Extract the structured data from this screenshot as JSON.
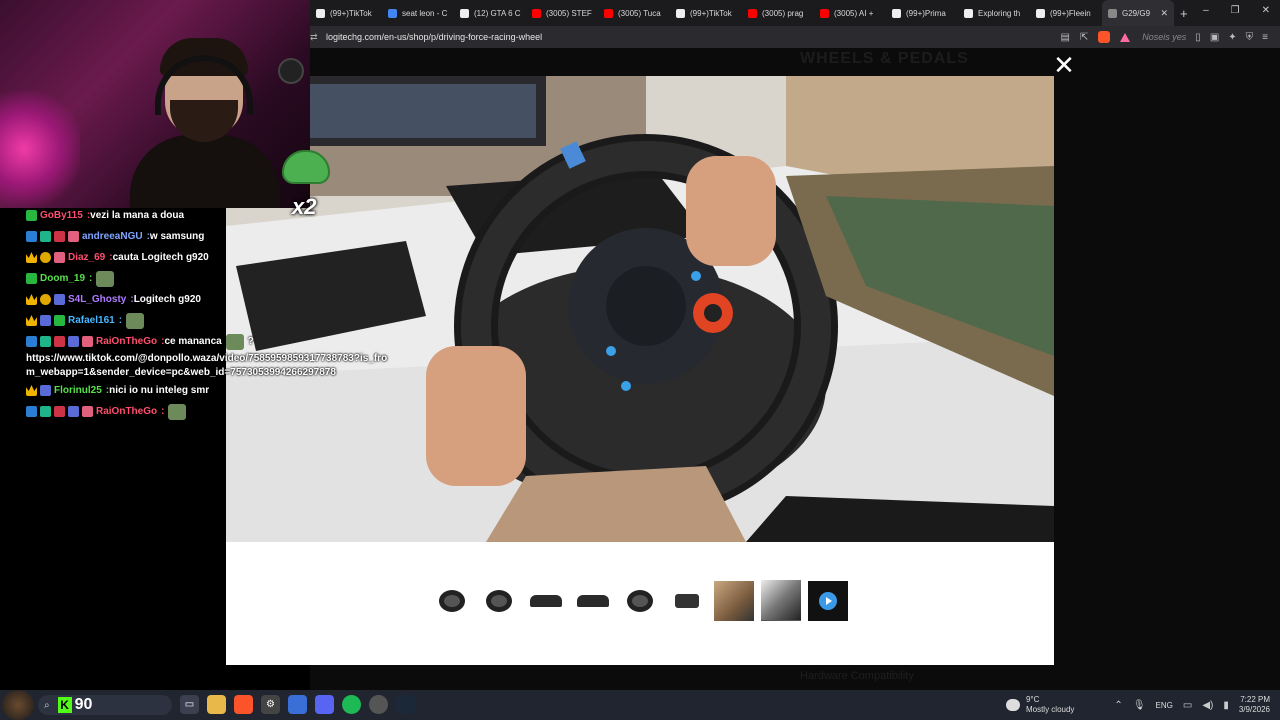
{
  "webcam": {
    "emote_multiplier": "x2"
  },
  "chat": {
    "messages": [
      {
        "user": "GoBy115",
        "user_color": "#ff4f6e",
        "text": "vezi la mana a doua",
        "badges": [
          "gem"
        ]
      },
      {
        "user": "andreeaNGU",
        "user_color": "#7ea6ff",
        "text": "w samsung",
        "badges": [
          "arrow",
          "grid",
          "heart",
          "gift"
        ]
      },
      {
        "user": "Diaz_69",
        "user_color": "#ff4f6e",
        "text": "cauta Logitech g920",
        "badges": [
          "crown",
          "dot",
          "gift"
        ]
      },
      {
        "user": "Doom_19",
        "user_color": "#56e04a",
        "text": "",
        "badges": [
          "gem"
        ],
        "emote": true
      },
      {
        "user": "S4L_Ghosty",
        "user_color": "#b07cff",
        "text": "Logitech g920",
        "badges": [
          "crown",
          "dot",
          "sub"
        ]
      },
      {
        "user": "Rafael161",
        "user_color": "#48b8ff",
        "text": "",
        "badges": [
          "crown",
          "sub",
          "gem"
        ],
        "emote": true
      },
      {
        "user": "RaiOnTheGo",
        "user_color": "#ff4f6e",
        "text": "ce mananca",
        "badges": [
          "arrow",
          "grid",
          "heart",
          "sub",
          "gift"
        ],
        "emote": true,
        "trail": "?"
      },
      {
        "user": "Florinul25",
        "user_color": "#56e04a",
        "text": "nici io nu inteleg smr",
        "badges": [
          "crown",
          "sub"
        ]
      },
      {
        "user": "RaiOnTheGo",
        "user_color": "#ff4f6e",
        "text": "",
        "badges": [
          "arrow",
          "grid",
          "heart",
          "sub",
          "gift"
        ],
        "emote": true
      }
    ],
    "link_text": "https://www.tiktok.com/@donpollo.waza/video/7585959859317738783?is_from_webapp=1&sender_device=pc&web_id=7573053994266297878"
  },
  "browser": {
    "tabs": [
      {
        "label": "(99+)TikTok",
        "fav_color": "#eee"
      },
      {
        "label": "seat leon - C",
        "fav_color": "#4285f4"
      },
      {
        "label": "(12) GTA 6 C",
        "fav_color": "#eee"
      },
      {
        "label": "(3005) STEF",
        "fav_color": "#ff0000"
      },
      {
        "label": "(3005) Tuca",
        "fav_color": "#ff0000"
      },
      {
        "label": "(99+)TikTok",
        "fav_color": "#eee"
      },
      {
        "label": "(3005) prag",
        "fav_color": "#ff0000"
      },
      {
        "label": "(3005) AI +",
        "fav_color": "#ff0000"
      },
      {
        "label": "(99+)Prima",
        "fav_color": "#eee"
      },
      {
        "label": "Exploring th",
        "fav_color": "#eee"
      },
      {
        "label": "(99+)Fleein",
        "fav_color": "#eee"
      },
      {
        "label": "G29/G9",
        "fav_color": "#888",
        "active": true
      }
    ],
    "url": "logitechg.com/en-us/shop/p/driving-force-racing-wheel",
    "faded_right": "Noseis yes"
  },
  "page": {
    "ghost_title": "WHEELS & PEDALS",
    "ghost_bottom": "Hardware Compatibility"
  },
  "gallery": {
    "thumbnails": [
      {
        "kind": "wheel-side"
      },
      {
        "kind": "wheel-front"
      },
      {
        "kind": "flat"
      },
      {
        "kind": "flat"
      },
      {
        "kind": "wheel-front"
      },
      {
        "kind": "pedals"
      },
      {
        "kind": "photo"
      },
      {
        "kind": "photo2",
        "selected": true
      },
      {
        "kind": "video"
      }
    ]
  },
  "taskbar": {
    "kick_count": "90",
    "weather_temp": "9°C",
    "weather_desc": "Mostly cloudy",
    "lang": "ENG",
    "time": "7:22 PM",
    "date": "3/9/2026"
  }
}
